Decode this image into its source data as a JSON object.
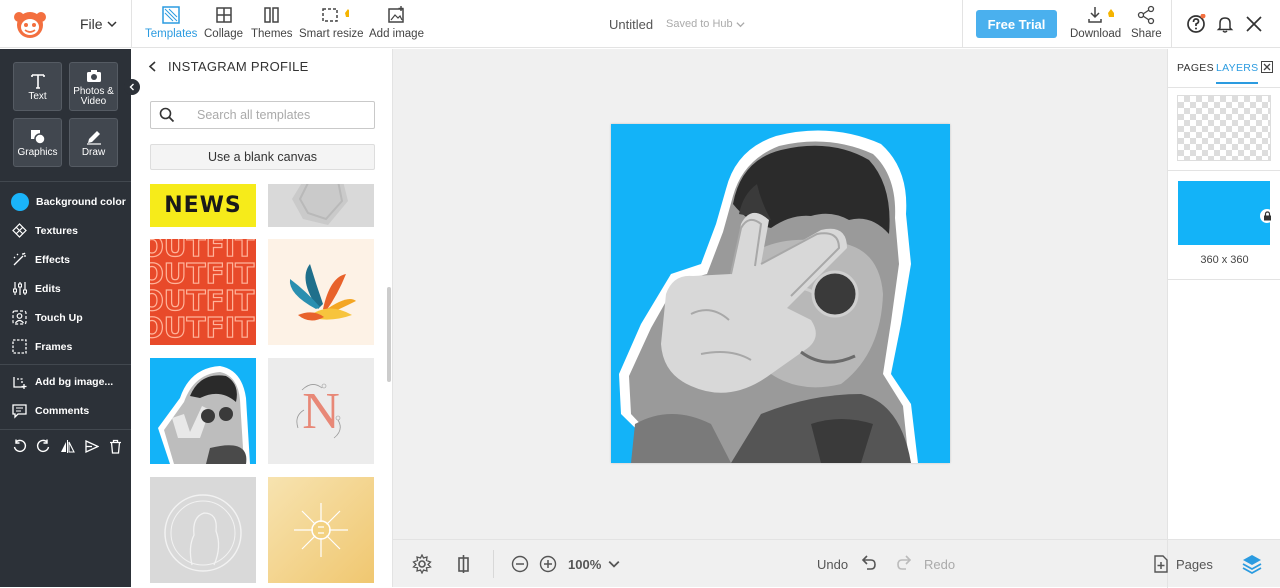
{
  "topbar": {
    "file_label": "File",
    "tools": [
      {
        "label": "Templates"
      },
      {
        "label": "Collage"
      },
      {
        "label": "Themes"
      },
      {
        "label": "Smart resize"
      },
      {
        "label": "Add image"
      }
    ],
    "doc_title": "Untitled",
    "saved_status": "Saved to Hub",
    "free_trial": "Free Trial",
    "download": "Download",
    "share": "Share"
  },
  "leftbar": {
    "big_buttons": [
      {
        "label": "Text"
      },
      {
        "label": "Photos & Video"
      },
      {
        "label": "Graphics"
      },
      {
        "label": "Draw"
      }
    ],
    "menu": [
      {
        "label": "Background color"
      },
      {
        "label": "Textures"
      },
      {
        "label": "Effects"
      },
      {
        "label": "Edits"
      },
      {
        "label": "Touch Up"
      },
      {
        "label": "Frames"
      },
      {
        "label": "Add bg image..."
      },
      {
        "label": "Comments"
      }
    ],
    "background_color": "#1ab4fa"
  },
  "panel": {
    "header": "INSTAGRAM PROFILE",
    "search_placeholder": "Search all templates",
    "blank_canvas": "Use a blank canvas",
    "thumb_texts": {
      "news": "NEWS",
      "outfit": "OUTFIT",
      "letter": "N"
    }
  },
  "bottombar": {
    "zoom": "100%",
    "undo": "Undo",
    "redo": "Redo",
    "pages": "Pages"
  },
  "rightpanel": {
    "tabs": [
      "PAGES",
      "LAYERS"
    ],
    "active_tab": "LAYERS",
    "layer_size": "360 x 360"
  },
  "colors": {
    "accent": "#2b9be0",
    "canvas_bg": "#13b3f8",
    "free_trial_bg": "#4ab0ee",
    "sidebar_bg": "#2c3138"
  }
}
